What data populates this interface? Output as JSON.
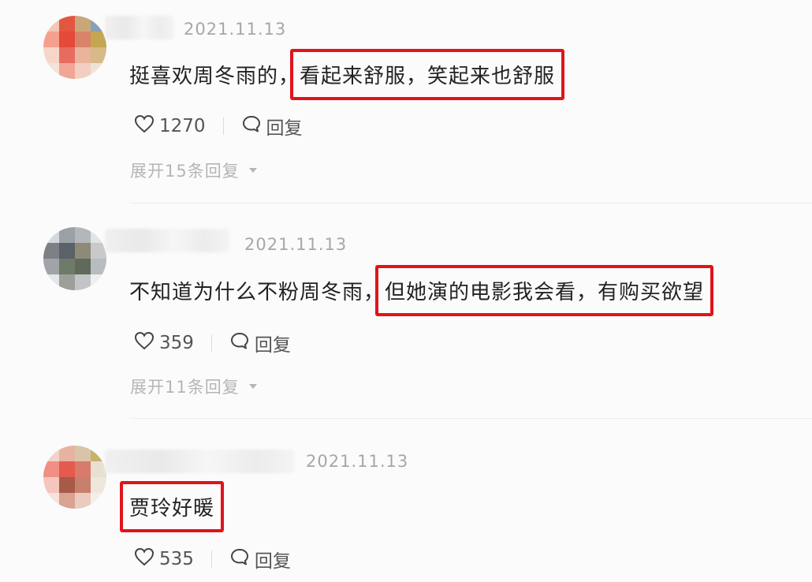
{
  "comments": [
    {
      "date": "2021.11.13",
      "text_plain": "挺喜欢周冬雨的，",
      "text_highlight": "看起来舒服，笑起来也舒服",
      "likes": "1270",
      "reply_label": "回复",
      "expand_label": "展开15条回复"
    },
    {
      "date": "2021.11.13",
      "text_plain": "不知道为什么不粉周冬雨，",
      "text_highlight": "但她演的电影我会看，有购买欲望",
      "likes": "359",
      "reply_label": "回复",
      "expand_label": "展开11条回复"
    },
    {
      "date": "2021.11.13",
      "text_plain": "",
      "text_highlight": "贾玲好暖",
      "likes": "535",
      "reply_label": "回复"
    }
  ],
  "colors": {
    "highlight_border": "#e0141b",
    "meta_text": "#a7a7a7"
  },
  "icons": {
    "like": "heart-outline-icon",
    "reply": "speech-bubble-icon",
    "expand": "caret-down-icon"
  }
}
